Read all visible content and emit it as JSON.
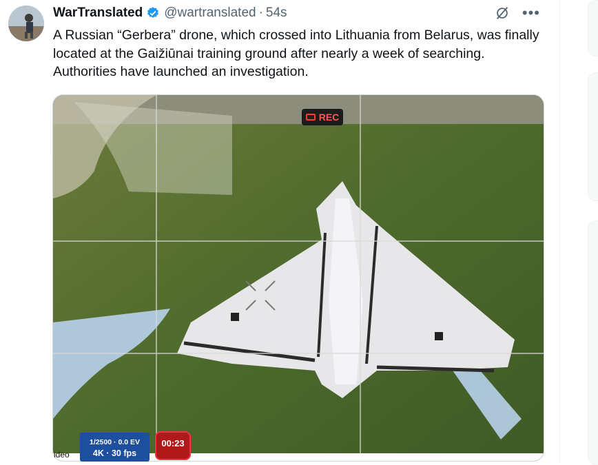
{
  "tweet": {
    "author_name": "WarTranslated",
    "handle": "@wartranslated",
    "separator": "·",
    "timestamp": "54s",
    "text": "A Russian “Gerbera” drone, which crossed into Lithuania from Belarus, was finally located at the Gaižiūnai training ground after nearly a week of searching. Authorities have launched an investigation.",
    "icons": {
      "verified": "verified-badge-icon",
      "grok": "grok-icon",
      "more": "more-options-icon"
    }
  },
  "media": {
    "rec_label": "REC",
    "video_label": "ideo",
    "exposure": "1/2500 · 0.0 EV",
    "format": "4K · 30 fps",
    "timer": "00:23"
  },
  "colors": {
    "accent": "#1d9bf0",
    "text": "#0f1419",
    "muted": "#536471",
    "rec": "#ff3b30"
  }
}
